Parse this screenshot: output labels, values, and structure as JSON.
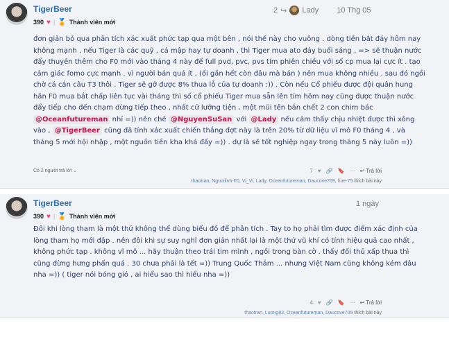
{
  "posts": [
    {
      "author": "TigerBeer",
      "points": "390",
      "rank": "Thành viên mới",
      "reply_count_badge": "2",
      "reply_to_user": "Lady",
      "date": "10 Thg 05",
      "paragraph_1": "đơn giản bỏ qua phân tích xác xuất phức tạp qua một bên , nói thế này cho vuông . dòng tiền bắt đáy hôm nay không mạnh . nếu Tiger là các quỹ , cá mập hay tự doanh , thì Tiger mua ato đáy buổi sáng , => sẽ thuận nước đẩy thuyền thêm cho F0 mới vào tháng 4 này để full pvd, pvc, pvs tím phiên chiều với số cp mua lại cực ít . tạo cảm giác fomo cực mạnh . vì người bán quá ít , (ối gần hết còn đâu mà bán ) nên mua không nhiều . sau đó ngồi chờ cá cắn câu T3 thôi . Tiger sẽ gỡ được 8% thua lỗ của tự doanh :)) . Còn nếu Cổ phiếu được đội quân hung hãn F0 mua bắt chấp liên tục vài tháng thì số cổ phiếu Tiger mua sẵn lên tím hôm nay cũng được thuận nước đẩy tiếp cho đến chạm dừng tiếp theo , nhất cử lưỡng tiện , một mũi tên bắn chết 2 con chim bác",
      "mention_1": "@Oceanfutureman",
      "text_1": "nhỉ =)) nên chê",
      "mention_2": "@NguyenSuSan",
      "text_2": "với",
      "mention_3": "@Lady",
      "text_3": "nếu cảm thấy chịu nhiệt được thì xông vào ,",
      "mention_4": "@TigerBeer",
      "text_4": "cũng đã tính xác xuất chiến thắng đợt này là trên 20% từ dữ liệu vĩ mô F0 tháng 4 , và tháng 5 mới hội nhập , một nguồn tiền kha khá đấy =)) . dự là sẽ tốt nghiệp ngay trong tháng 5 này luôn =))",
      "replies_summary": "Có 2 người trả lời",
      "likes": "7",
      "reply_label": "Trả lời",
      "likers": "thaotran, Nguoilinh-F0, Vi_Vi, Lady, Oceanfutureman, Daucove709, hue-75",
      "likers_tail": "thích bài này"
    },
    {
      "author": "TigerBeer",
      "points": "390",
      "rank": "Thành viên mới",
      "date": "1 ngày",
      "paragraph_1": "Đôi khi lòng tham là một thứ không thể dùng biểu đồ để phân tích . Tay to họ phải tìm được điểm xác định của lòng tham họ mới đập . nên đôi khi sự suy nghĩ đơn giản nhất lại là một thứ vũ khí có tính hiệu quả cao nhất , không phức tạp . không vĩ mô ... hãy thuận theo trái tim mình , ngồi trong bàn cờ . thấy đối thủ xấp thua thì cũng đừng hưng phấn quá . 30 chưa phải là tết =)) Trung Quốc Thắm ... nhưng Việt Nam cũng không kém đâu nha =)) ( tiger nói bóng gió , ai hiểu sao thì hiểu nha =))",
      "likes": "4",
      "reply_label": "Trả lời",
      "likers": "thaotran, Luong82, Oceanfutureman, Daucove709",
      "likers_tail": "thích bài này"
    }
  ],
  "colors": {
    "author": "#2f6fb0",
    "mention": "#c2184b",
    "body_text": "#2a3c6a",
    "post_bg": "#f2f3f6"
  },
  "icons": [
    "heart-icon",
    "medal-icon",
    "reply-arrow-icon",
    "heart-like-icon",
    "link-icon",
    "bookmark-icon",
    "more-icon",
    "reply-icon"
  ]
}
